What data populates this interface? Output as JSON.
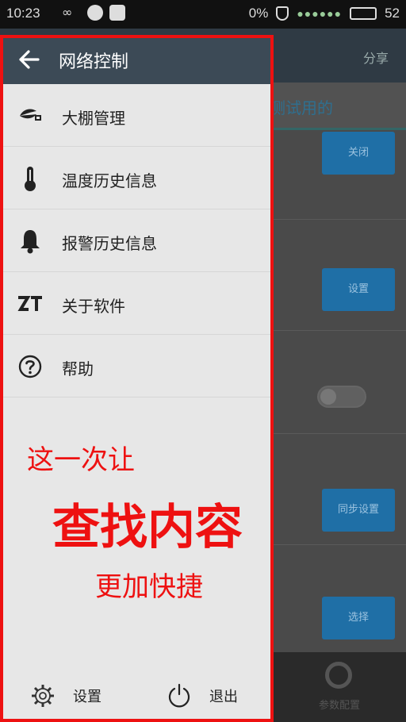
{
  "status_bar": {
    "time": "10:23",
    "battery_text": "0%",
    "signal_text": "52"
  },
  "background_app": {
    "share_label": "分享",
    "tab_label": "测试用的",
    "buttons": [
      "关闭",
      "设置",
      "同步设置",
      "选择"
    ],
    "bottom_nav_label": "参数配置"
  },
  "drawer": {
    "title": "网络控制",
    "items": [
      {
        "label": "大棚管理",
        "icon": "leaf-house-icon"
      },
      {
        "label": "温度历史信息",
        "icon": "thermometer-icon"
      },
      {
        "label": "报警历史信息",
        "icon": "bell-icon"
      },
      {
        "label": "关于软件",
        "icon": "zt-logo-icon"
      },
      {
        "label": "帮助",
        "icon": "help-circle-icon"
      }
    ],
    "promo": {
      "line1": "这一次让",
      "line2": "查找内容",
      "line3": "更加快捷"
    },
    "footer": {
      "settings_label": "设置",
      "exit_label": "退出"
    }
  },
  "colors": {
    "drawer_header": "#3c4a56",
    "highlight_border": "#ee1111",
    "accent_button": "#1f6fa6"
  }
}
